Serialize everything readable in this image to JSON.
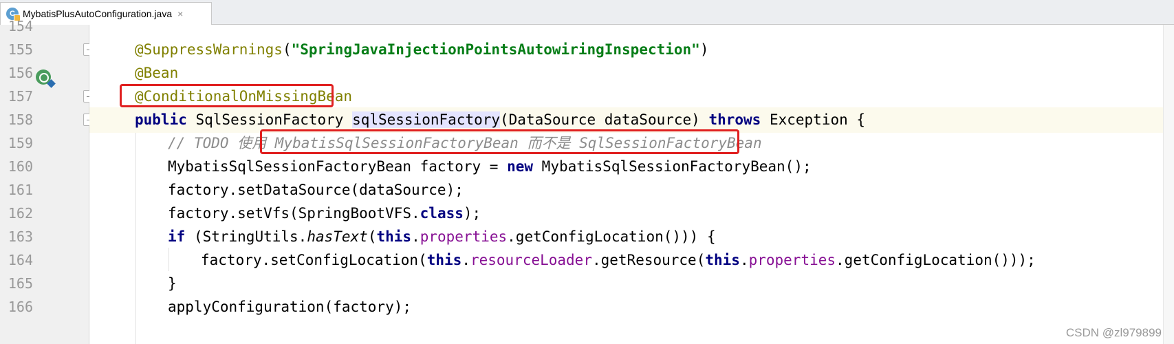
{
  "tab": {
    "icon_letter": "C",
    "title": "MybatisPlusAutoConfiguration.java",
    "close": "×"
  },
  "lines": [
    {
      "num": "154"
    },
    {
      "num": "155",
      "ann": "@SuppressWarnings",
      "p1": "(",
      "str": "\"SpringJavaInjectionPointsAutowiringInspection\"",
      "p2": ")"
    },
    {
      "num": "156",
      "ann": "@Bean"
    },
    {
      "num": "157",
      "ann": "@ConditionalOnMissingBean"
    },
    {
      "num": "158",
      "kw": "public",
      "t1": " SqlSessionFactory ",
      "hl": "sqlSessionFactory",
      "t2": "(DataSource dataSource) ",
      "kw2": "throws",
      "t3": " Exception {"
    },
    {
      "num": "159",
      "c1": "// TODO 使用 ",
      "c2": "MybatisSqlSessionFactoryBean 而不是 SqlSessionFactoryBean"
    },
    {
      "num": "160",
      "t1": "MybatisSqlSessionFactoryBean factory = ",
      "kw": "new",
      "t2": " MybatisSqlSessionFactoryBean();"
    },
    {
      "num": "161",
      "t1": "factory.setDataSource(dataSource);"
    },
    {
      "num": "162",
      "t1": "factory.setVfs(SpringBootVFS.",
      "kw": "class",
      "t2": ");"
    },
    {
      "num": "163",
      "kw": "if",
      "t1": " (StringUtils.",
      "it": "hasText",
      "t2": "(",
      "kw2": "this",
      "t3": ".",
      "f": "properties",
      "t4": ".getConfigLocation())) {"
    },
    {
      "num": "164",
      "t1": "factory.setConfigLocation(",
      "kw": "this",
      "t2": ".",
      "f": "resourceLoader",
      "t3": ".getResource(",
      "kw2": "this",
      "t4": ".",
      "f2": "properties",
      "t5": ".getConfigLocation()));"
    },
    {
      "num": "165",
      "t1": "}"
    },
    {
      "num": "166",
      "t1": "applyConfiguration(factory);"
    }
  ],
  "watermark": "CSDN @zl979899",
  "colors": {
    "annotation": "#808000",
    "string": "#067d17",
    "keyword": "#000080",
    "field": "#871094",
    "comment": "#8c8c8c",
    "highlight_box": "#e02020"
  }
}
